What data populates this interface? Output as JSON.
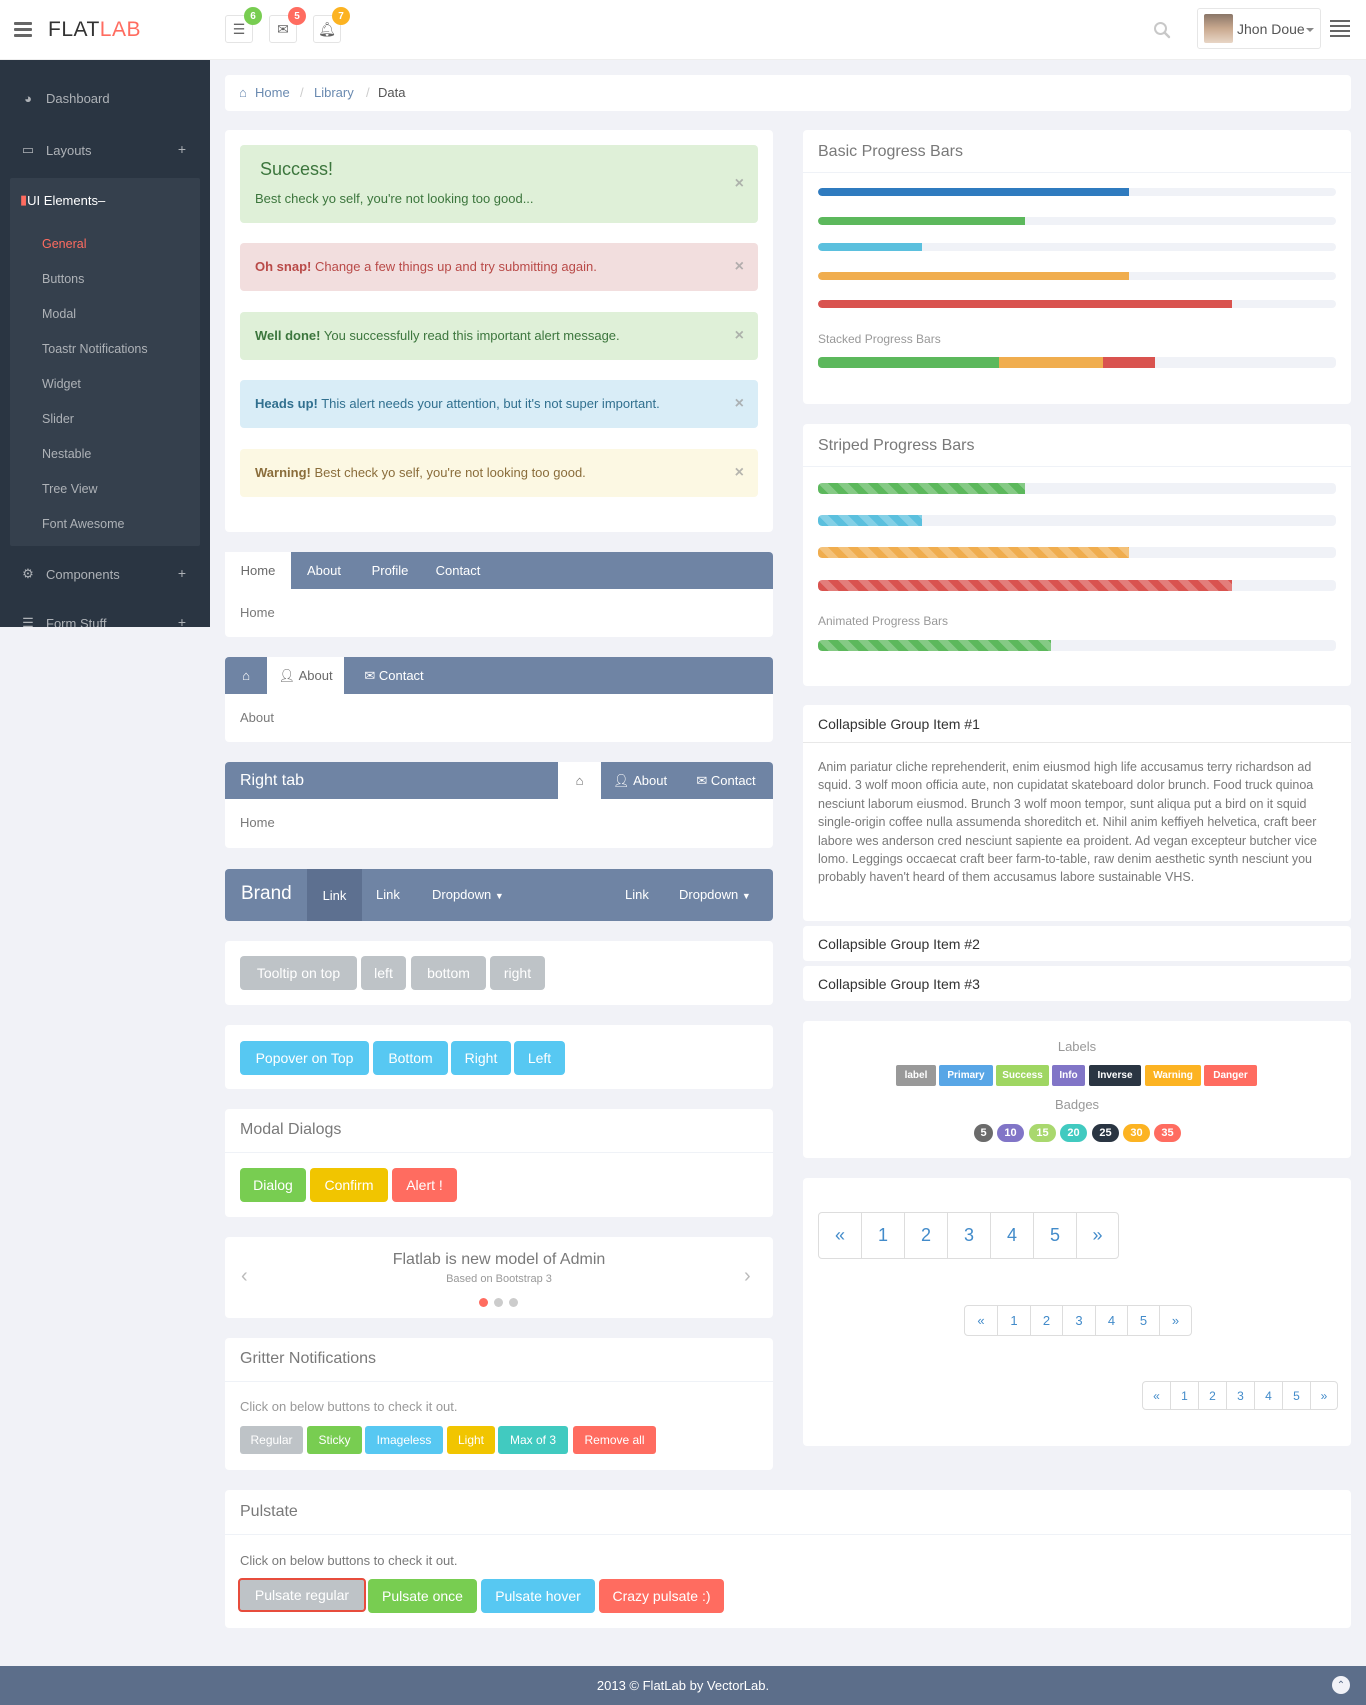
{
  "app": {
    "logo_main": "FLAT",
    "logo_accent": "LAB"
  },
  "header": {
    "badges": [
      {
        "icon": "tasks-icon",
        "count": "6",
        "color": "#78cd51"
      },
      {
        "icon": "envelope-icon",
        "count": "5",
        "color": "#ff6c60"
      },
      {
        "icon": "bell-icon",
        "count": "7",
        "color": "#fcb322"
      }
    ],
    "user_name": "Jhon Doue"
  },
  "sidebar": {
    "items": [
      {
        "label": "Dashboard",
        "icon": "dashboard-icon"
      },
      {
        "label": "Layouts",
        "icon": "laptop-icon",
        "toggle": "+"
      },
      {
        "label": "UI Elements",
        "icon": "book-icon",
        "toggle": "–"
      },
      {
        "label": "Components",
        "icon": "cogs-icon",
        "toggle": "+"
      },
      {
        "label": "Form Stuff",
        "icon": "tasks-icon",
        "toggle": "+"
      }
    ],
    "sub_items": [
      "General",
      "Buttons",
      "Modal",
      "Toastr Notifications",
      "Widget",
      "Slider",
      "Nestable",
      "Tree View",
      "Font Awesome"
    ],
    "active_sub": "General"
  },
  "breadcrumb": [
    "Home",
    "Library",
    "Data"
  ],
  "alerts": {
    "success_title": "Success!",
    "success_text": "Best check yo self, you're not looking too good...",
    "danger_strong": "Oh snap!",
    "danger_text": "Change a few things up and try submitting again.",
    "welldone_strong": "Well done!",
    "welldone_text": "You successfully read this important alert message.",
    "info_strong": "Heads up!",
    "info_text": "This alert needs your attention, but it's not super important.",
    "warning_strong": "Warning!",
    "warning_text": "Best check yo self, you're not looking too good.",
    "close": "×"
  },
  "tabs1": {
    "tabs": [
      "Home",
      "About",
      "Profile",
      "Contact"
    ],
    "content": "Home"
  },
  "tabs2": {
    "tabs": [
      "About",
      "Contact"
    ],
    "content": "About"
  },
  "tabs3": {
    "title": "Right tab",
    "tabs": [
      "About",
      "Contact"
    ],
    "content": "Home"
  },
  "navbar": {
    "brand": "Brand",
    "links": [
      "Link",
      "Link",
      "Dropdown",
      "Link",
      "Dropdown"
    ]
  },
  "tooltips": [
    "Tooltip on top",
    "left",
    "bottom",
    "right"
  ],
  "popovers": [
    "Popover on Top",
    "Bottom",
    "Right",
    "Left"
  ],
  "modal": {
    "title": "Modal Dialogs",
    "buttons": [
      "Dialog",
      "Confirm",
      "Alert !"
    ]
  },
  "carousel": {
    "title": "Flatlab is new model of Admin",
    "subtitle": "Based on Bootstrap 3",
    "prev": "‹",
    "next": "›"
  },
  "gritter": {
    "title": "Gritter Notifications",
    "hint": "Click on below buttons to check it out.",
    "buttons": [
      "Regular",
      "Sticky",
      "Imageless",
      "Light",
      "Max of 3",
      "Remove all"
    ]
  },
  "pulsate": {
    "title": "Pulstate",
    "hint": "Click on below buttons to check it out.",
    "buttons": [
      "Pulsate regular",
      "Pulsate once",
      "Pulsate hover",
      "Crazy pulsate :)"
    ]
  },
  "progress": {
    "basic_title": "Basic Progress Bars",
    "basic": [
      {
        "value": 60,
        "color": "#2f7bbf"
      },
      {
        "value": 40,
        "color": "#5cb85c"
      },
      {
        "value": 20,
        "color": "#5bc0de"
      },
      {
        "value": 60,
        "color": "#f0ad4e"
      },
      {
        "value": 80,
        "color": "#d9534f"
      }
    ],
    "stacked_title": "Stacked Progress Bars",
    "stacked": [
      {
        "value": 35,
        "color": "#5cb85c"
      },
      {
        "value": 20,
        "color": "#f0ad4e"
      },
      {
        "value": 10,
        "color": "#d9534f"
      }
    ],
    "striped_title": "Striped Progress Bars",
    "striped": [
      {
        "value": 40,
        "color": "#5cb85c"
      },
      {
        "value": 20,
        "color": "#5bc0de"
      },
      {
        "value": 60,
        "color": "#f0ad4e"
      },
      {
        "value": 80,
        "color": "#d9534f"
      }
    ],
    "animated_title": "Animated Progress Bars",
    "animated": {
      "value": 45,
      "color": "#5cb85c"
    }
  },
  "collapse": {
    "item1": "Collapsible Group Item #1",
    "item1_body": "Anim pariatur cliche reprehenderit, enim eiusmod high life accusamus terry richardson ad squid. 3 wolf moon officia aute, non cupidatat skateboard dolor brunch. Food truck quinoa nesciunt laborum eiusmod. Brunch 3 wolf moon tempor, sunt aliqua put a bird on it squid single-origin coffee nulla assumenda shoreditch et. Nihil anim keffiyeh helvetica, craft beer labore wes anderson cred nesciunt sapiente ea proident. Ad vegan excepteur butcher vice lomo. Leggings occaecat craft beer farm-to-table, raw denim aesthetic synth nesciunt you probably haven't heard of them accusamus labore sustainable VHS.",
    "item2": "Collapsible Group Item #2",
    "item3": "Collapsible Group Item #3"
  },
  "labels": {
    "title": "Labels",
    "items": [
      {
        "text": "label",
        "color": "#999999"
      },
      {
        "text": "Primary",
        "color": "#58a6e6"
      },
      {
        "text": "Success",
        "color": "#9fd662"
      },
      {
        "text": "Info",
        "color": "#8175c7"
      },
      {
        "text": "Inverse",
        "color": "#2a3542"
      },
      {
        "text": "Warning",
        "color": "#fcb322"
      },
      {
        "text": "Danger",
        "color": "#ff6c60"
      }
    ],
    "badges_title": "Badges",
    "badges": [
      {
        "text": "5",
        "color": "#6b6b6b"
      },
      {
        "text": "10",
        "color": "#8175c7"
      },
      {
        "text": "15",
        "color": "#a9d86e"
      },
      {
        "text": "20",
        "color": "#41cac0"
      },
      {
        "text": "25",
        "color": "#2a3542"
      },
      {
        "text": "30",
        "color": "#fcb322"
      },
      {
        "text": "35",
        "color": "#ff6c60"
      }
    ]
  },
  "pagination": {
    "prev": "«",
    "next": "»",
    "pages": [
      "1",
      "2",
      "3",
      "4",
      "5"
    ]
  },
  "footer": {
    "text": "2013 © FlatLab by VectorLab.",
    "up": "⌃"
  }
}
